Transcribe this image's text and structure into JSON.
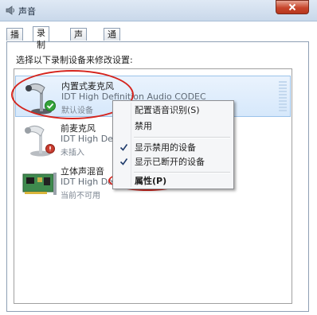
{
  "window": {
    "title": "声音",
    "close_icon": "close-icon"
  },
  "tabs": [
    {
      "label": "播放",
      "active": false
    },
    {
      "label": "录制",
      "active": true
    },
    {
      "label": "声音",
      "active": false
    },
    {
      "label": "通信",
      "active": false
    }
  ],
  "instruction": "选择以下录制设备来修改设置:",
  "devices": [
    {
      "name": "内置式麦克风",
      "driver": "IDT High Definition Audio CODEC",
      "status": "默认设备",
      "selected": true,
      "icon": "microphone-icon",
      "badge": "default-check-badge"
    },
    {
      "name": "前麦克风",
      "driver": "IDT High Def",
      "status": "未插入",
      "selected": false,
      "icon": "microphone-icon",
      "badge": "unplugged-badge"
    },
    {
      "name": "立体声混音",
      "driver": "IDT High Def",
      "status": "当前不可用",
      "selected": false,
      "icon": "sound-card-icon",
      "badge": ""
    }
  ],
  "context_menu": {
    "items": [
      {
        "label": "配置语音识别(S)",
        "checked": false
      },
      {
        "label": "禁用",
        "checked": false
      },
      {
        "label": "显示禁用的设备",
        "checked": true
      },
      {
        "label": "显示已断开的设备",
        "checked": true
      },
      {
        "label": "属性(P)",
        "checked": false,
        "default": true
      }
    ]
  },
  "colors": {
    "annotation": "#d5241d",
    "selection": "#d6e8fb",
    "close_button": "#c7462c"
  }
}
